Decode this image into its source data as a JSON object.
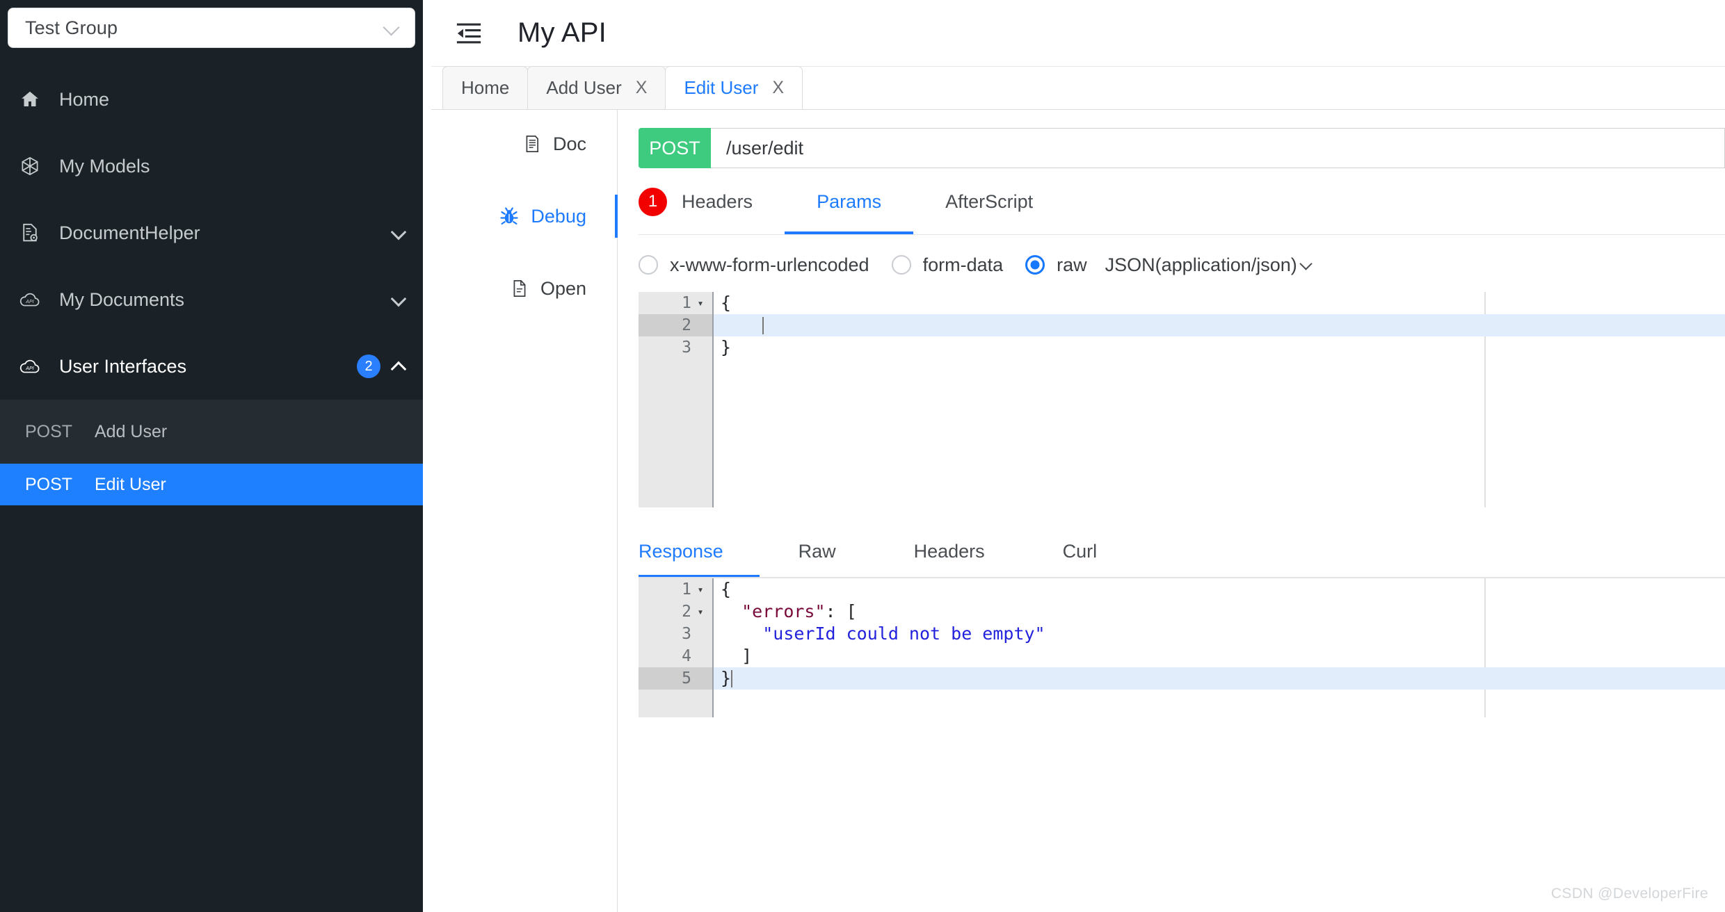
{
  "sidebar": {
    "group_select": {
      "value": "Test Group",
      "chevron": "chevron-down-icon"
    },
    "items": [
      {
        "label": "Home",
        "icon": "home-icon",
        "expandable": false
      },
      {
        "label": "My Models",
        "icon": "cube-icon",
        "expandable": false
      },
      {
        "label": "DocumentHelper",
        "icon": "document-gear-icon",
        "expandable": true
      },
      {
        "label": "My Documents",
        "icon": "api-cloud-icon",
        "expandable": true
      },
      {
        "label": "User Interfaces",
        "icon": "api-cloud-icon",
        "expandable": true,
        "badge": "2",
        "expanded": true
      }
    ],
    "endpoints": [
      {
        "method": "POST",
        "name": "Add User",
        "selected": false
      },
      {
        "method": "POST",
        "name": "Edit User",
        "selected": true
      }
    ]
  },
  "header": {
    "collapse_icon": "collapse-sidebar-icon",
    "title": "My API"
  },
  "tabs": [
    {
      "label": "Home",
      "closable": false,
      "active": false
    },
    {
      "label": "Add User",
      "closable": true,
      "close_label": "X",
      "active": false
    },
    {
      "label": "Edit User",
      "closable": true,
      "close_label": "X",
      "active": true
    }
  ],
  "vnav": [
    {
      "label": "Doc",
      "icon": "doc-icon",
      "active": false
    },
    {
      "label": "Debug",
      "icon": "bug-icon",
      "active": true
    },
    {
      "label": "Open",
      "icon": "file-icon",
      "active": false
    }
  ],
  "request": {
    "method": "POST",
    "url": "/user/edit",
    "subtabs": [
      {
        "label": "Headers",
        "badge": "1",
        "active": false
      },
      {
        "label": "Params",
        "active": true
      },
      {
        "label": "AfterScript",
        "active": false
      }
    ],
    "body_types": [
      {
        "label": "x-www-form-urlencoded",
        "checked": false
      },
      {
        "label": "form-data",
        "checked": false
      },
      {
        "label": "raw",
        "checked": true
      }
    ],
    "content_type": "JSON(application/json)",
    "editor_lines": [
      {
        "num": "1",
        "fold": "▾",
        "text": "{",
        "highlighted": false
      },
      {
        "num": "2",
        "fold": "",
        "text": "    ",
        "highlighted": true
      },
      {
        "num": "3",
        "fold": "",
        "text": "}",
        "highlighted": false
      }
    ]
  },
  "response": {
    "tabs": [
      {
        "label": "Response",
        "active": true
      },
      {
        "label": "Raw",
        "active": false
      },
      {
        "label": "Headers",
        "active": false
      },
      {
        "label": "Curl",
        "active": false
      }
    ],
    "editor_lines": [
      {
        "num": "1",
        "fold": "▾",
        "highlighted": false,
        "plain": "{"
      },
      {
        "num": "2",
        "fold": "▾",
        "highlighted": false,
        "key": "\"errors\"",
        "after": ": ["
      },
      {
        "num": "3",
        "fold": "",
        "highlighted": false,
        "str": "\"userId could not be empty\""
      },
      {
        "num": "4",
        "fold": "",
        "highlighted": false,
        "plain": "  ]"
      },
      {
        "num": "5",
        "fold": "",
        "highlighted": true,
        "plain": "}"
      }
    ]
  },
  "watermark": "CSDN @DeveloperFire",
  "colors": {
    "sidebar_bg": "#1b2227",
    "selected_blue": "#1e80ff",
    "accent_blue": "#1e7bff",
    "method_green": "#3ecb7f",
    "badge_red": "#f20000"
  }
}
